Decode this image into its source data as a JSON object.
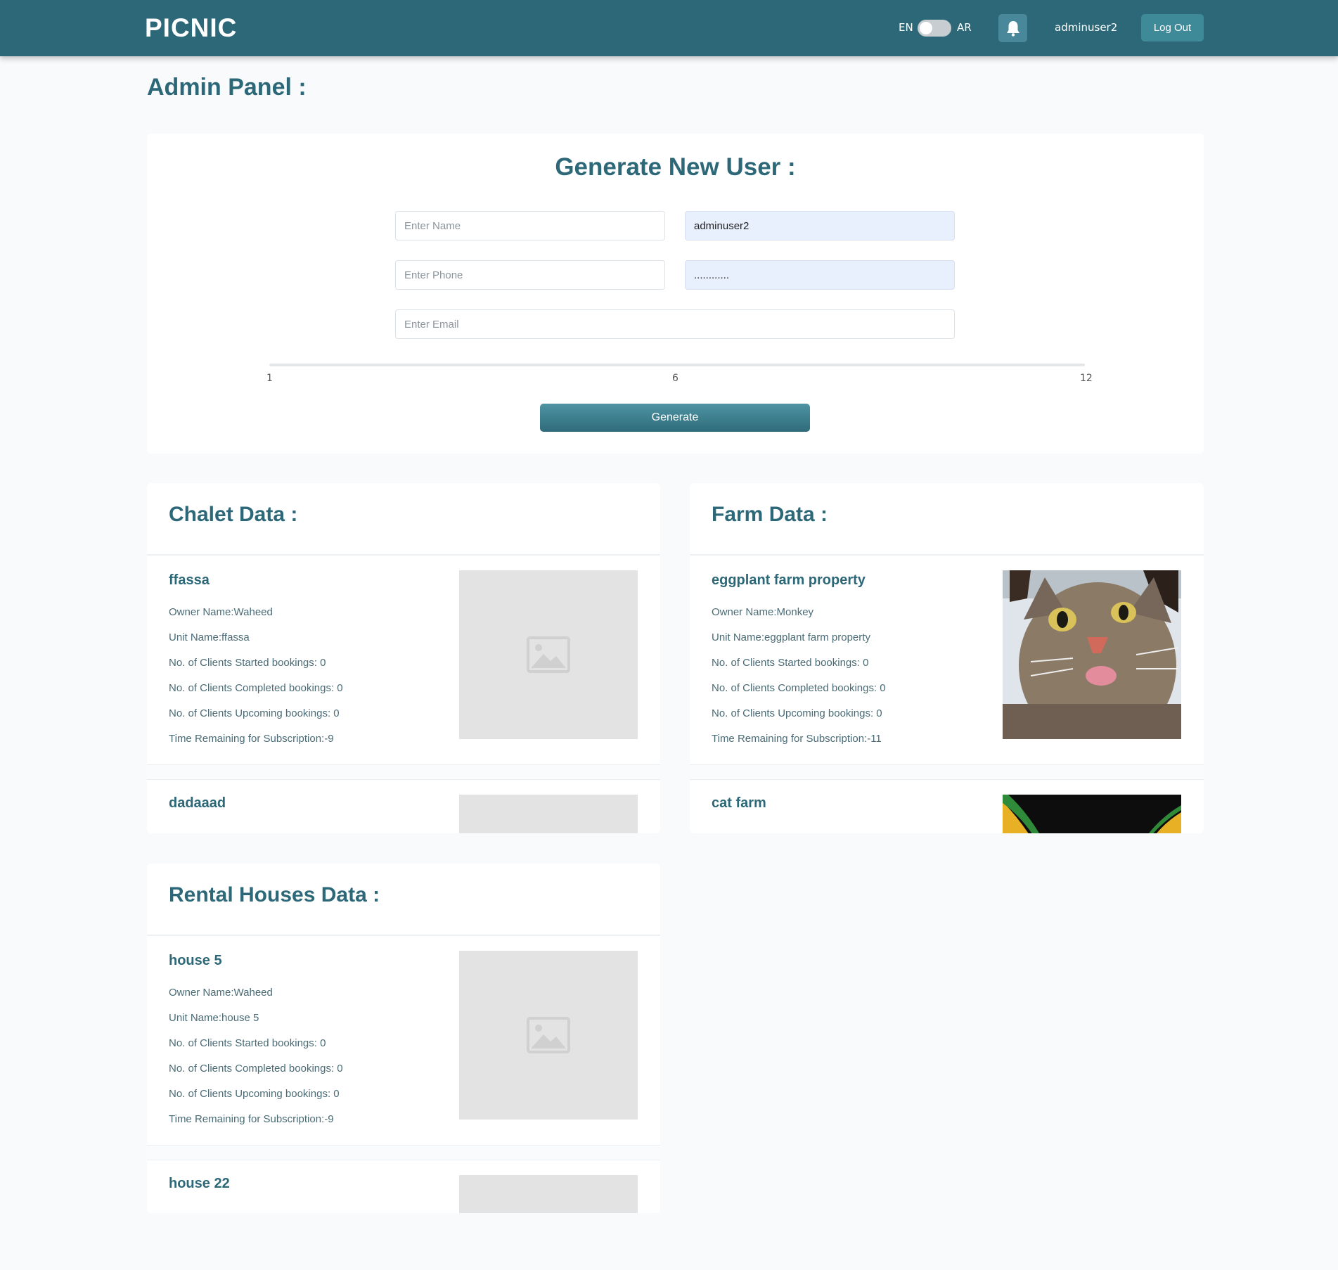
{
  "header": {
    "logo": "PICNIC",
    "lang_en": "EN",
    "lang_ar": "AR",
    "username": "adminuser2",
    "logout_label": "Log Out",
    "icons": {
      "notifications": "bell-icon"
    }
  },
  "page_title": "Admin Panel :",
  "generate_user": {
    "title": "Generate New User :",
    "name_placeholder": "Enter Name",
    "username_value": "adminuser2",
    "phone_placeholder": "Enter Phone",
    "password_value": "............",
    "email_placeholder": "Enter Email",
    "slider": {
      "min_label": "1",
      "mid_label": "6",
      "max_label": "12",
      "value": 1
    },
    "generate_label": "Generate"
  },
  "chalet": {
    "title": "Chalet Data :",
    "items": [
      {
        "name": "ffassa",
        "owner": "Owner Name:Waheed",
        "unit": "Unit Name:ffassa",
        "started": "No. of Clients Started bookings: 0",
        "completed": "No. of Clients Completed bookings: 0",
        "upcoming": "No. of Clients Upcoming bookings: 0",
        "remaining": "Time Remaining for Subscription:-9",
        "image": "image-placeholder-icon"
      },
      {
        "name": "dadaaad",
        "image": "image-placeholder"
      }
    ]
  },
  "farm": {
    "title": "Farm Data :",
    "items": [
      {
        "name": "eggplant farm property",
        "owner": "Owner Name:Monkey",
        "unit": "Unit Name:eggplant farm property",
        "started": "No. of Clients Started bookings: 0",
        "completed": "No. of Clients Completed bookings: 0",
        "upcoming": "No. of Clients Upcoming bookings: 0",
        "remaining": "Time Remaining for Subscription:-11",
        "image": "cat-photo"
      },
      {
        "name": "cat farm",
        "image": "cat-photo"
      }
    ]
  },
  "rental": {
    "title": "Rental Houses Data :",
    "items": [
      {
        "name": "house 5",
        "owner": "Owner Name:Waheed",
        "unit": "Unit Name:house 5",
        "started": "No. of Clients Started bookings: 0",
        "completed": "No. of Clients Completed bookings: 0",
        "upcoming": "No. of Clients Upcoming bookings: 0",
        "remaining": "Time Remaining for Subscription:-9",
        "image": "image-placeholder-icon"
      },
      {
        "name": "house 22",
        "image": "image-placeholder"
      }
    ]
  },
  "colors": {
    "primary": "#2d6878",
    "accent": "#3f8a98",
    "background": "#f8fafc"
  }
}
